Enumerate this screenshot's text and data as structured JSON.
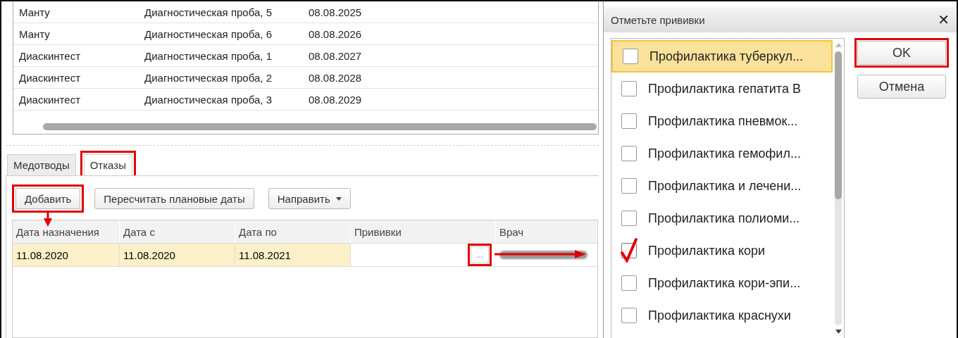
{
  "top_table": {
    "rows": [
      {
        "cells": [
          "Манту",
          "Диагностическая проба, 5",
          "08.08.2025"
        ]
      },
      {
        "cells": [
          "Манту",
          "Диагностическая проба, 6",
          "08.08.2026"
        ]
      },
      {
        "cells": [
          "Диаскинтест",
          "Диагностическая проба, 1",
          "08.08.2027"
        ]
      },
      {
        "cells": [
          "Диаскинтест",
          "Диагностическая проба, 2",
          "08.08.2028"
        ]
      },
      {
        "cells": [
          "Диаскинтест",
          "Диагностическая проба, 3",
          "08.08.2029"
        ]
      }
    ]
  },
  "tabs": [
    {
      "label": "Медотводы",
      "selected": false,
      "highlighted": false
    },
    {
      "label": "Отказы",
      "selected": true,
      "highlighted": true
    }
  ],
  "toolbar": [
    {
      "label": "Добавить",
      "kind": "button",
      "highlighted": true,
      "pointer_arrow": true
    },
    {
      "label": "Пересчитать плановые даты",
      "kind": "button",
      "highlighted": false,
      "pointer_arrow": false
    },
    {
      "label": "Направить",
      "kind": "dropdown",
      "highlighted": false,
      "pointer_arrow": false
    }
  ],
  "grid": {
    "columns": [
      "Дата назначения",
      "Дата с",
      "Дата по",
      "Прививки",
      "Врач"
    ],
    "rows": [
      {
        "selected": true,
        "cells": [
          "11.08.2020",
          "11.08.2020",
          "11.08.2021"
        ],
        "picker": {
          "label": "...",
          "highlighted": true,
          "pointer_arrow": true
        },
        "doctor_redacted": true
      }
    ]
  },
  "dialog": {
    "title": "Отметьте прививки",
    "close": "✕",
    "items": [
      {
        "label": "Профилактика туберкул...",
        "checked": false,
        "selected": true
      },
      {
        "label": "Профилактика гепатита В",
        "checked": false,
        "selected": false
      },
      {
        "label": "Профилактика пневмок...",
        "checked": false,
        "selected": false
      },
      {
        "label": "Профилактика гемофил...",
        "checked": false,
        "selected": false
      },
      {
        "label": "Профилактика и лечени...",
        "checked": false,
        "selected": false
      },
      {
        "label": "Профилактика полиоми...",
        "checked": false,
        "selected": false
      },
      {
        "label": "Профилактика кори",
        "checked": true,
        "selected": false
      },
      {
        "label": "Профилактика кори-эпи...",
        "checked": false,
        "selected": false
      },
      {
        "label": "Профилактика краснухи",
        "checked": false,
        "selected": false
      }
    ],
    "buttons": [
      {
        "label": "OK",
        "highlighted": true
      },
      {
        "label": "Отмена",
        "highlighted": false
      }
    ]
  }
}
